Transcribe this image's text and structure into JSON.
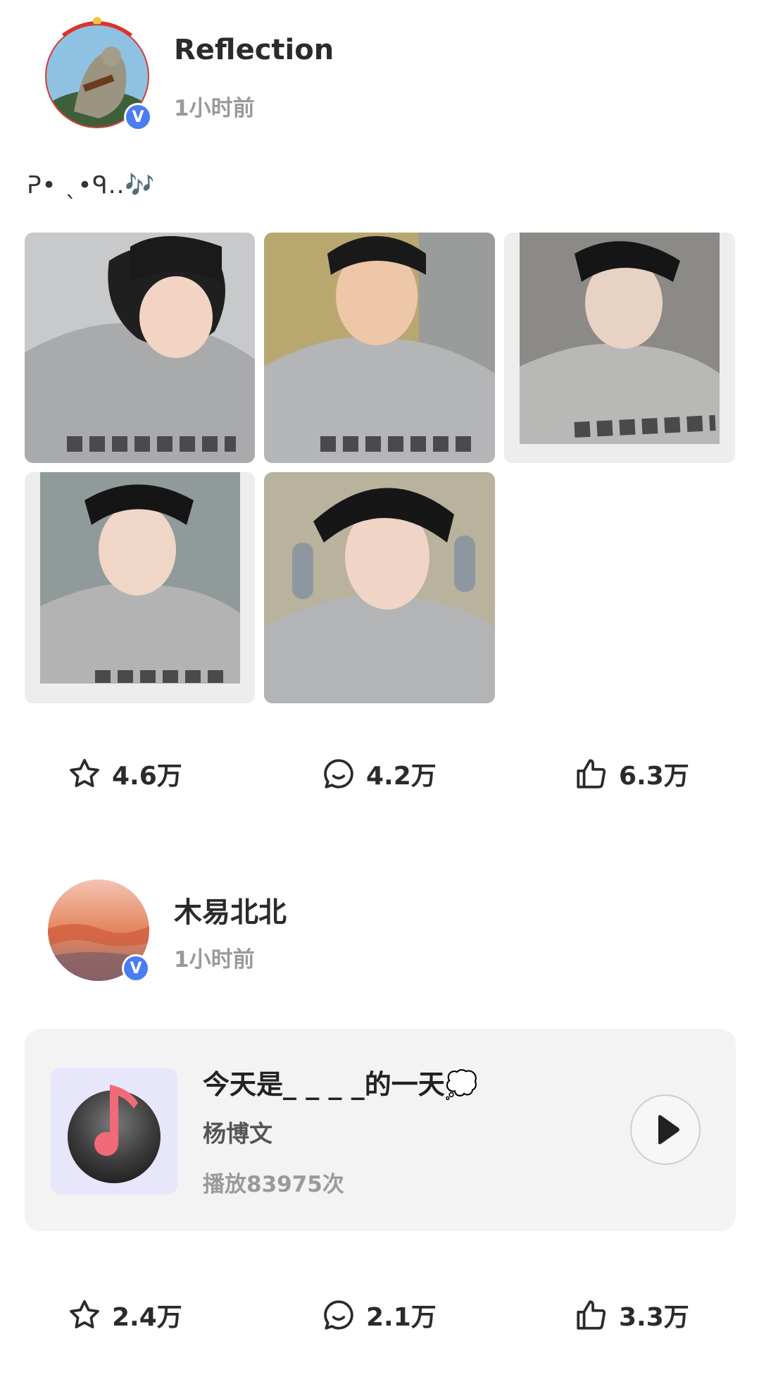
{
  "post1": {
    "username": "Reflection",
    "time": "1小时前",
    "caption": "ᕈ• ˎ•ᑫ..🎶",
    "photos": [
      "photo-1",
      "photo-2",
      "photo-3",
      "photo-4",
      "photo-5"
    ],
    "actions": {
      "favorite": "4.6万",
      "comment": "4.2万",
      "like": "6.3万"
    }
  },
  "post2": {
    "username": "木易北北",
    "time": "1小时前",
    "music": {
      "title": "今天是_ _ _ _的一天💭",
      "artist": "杨博文",
      "plays": "播放83975次"
    },
    "actions": {
      "favorite": "2.4万",
      "comment": "2.1万",
      "like": "3.3万"
    }
  },
  "colors": {
    "accent": "#4a7cf4",
    "music_note": "#f06a78"
  }
}
